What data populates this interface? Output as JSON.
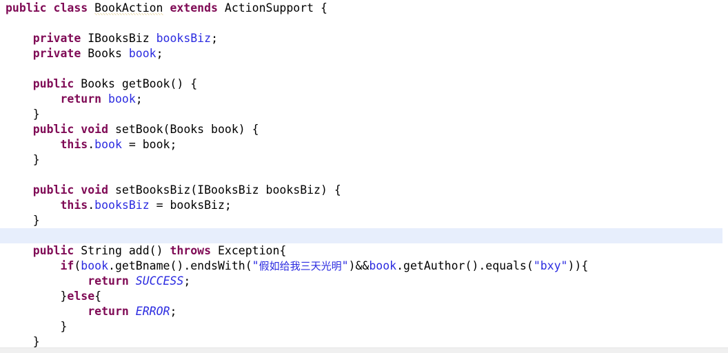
{
  "editor": {
    "language": "java",
    "class_name": "BookAction",
    "colors": {
      "background": "#ffffff",
      "foreground": "#000000",
      "keyword": "#7f0a55",
      "identifier": "#2a2ae0",
      "string": "#2a2ae0",
      "constant": "#2a2ae0",
      "current_line_highlight": "#e7eefc",
      "warning_underline": "#c9a227",
      "status_strip": "#f0f0f0"
    },
    "current_line_number": 17,
    "warning_token": "BookAction"
  },
  "code": {
    "lines": [
      {
        "n": 1,
        "indent": 0,
        "tokens": [
          {
            "t": "kw",
            "v": "public"
          },
          {
            "t": "pl",
            "v": " "
          },
          {
            "t": "kw",
            "v": "class"
          },
          {
            "t": "pl",
            "v": " "
          },
          {
            "t": "warn",
            "v": "BookAction"
          },
          {
            "t": "pl",
            "v": " "
          },
          {
            "t": "kw",
            "v": "extends"
          },
          {
            "t": "pl",
            "v": " ActionSupport {"
          }
        ]
      },
      {
        "n": 2,
        "indent": 0,
        "tokens": []
      },
      {
        "n": 3,
        "indent": 1,
        "tokens": [
          {
            "t": "kw",
            "v": "private"
          },
          {
            "t": "pl",
            "v": " IBooksBiz "
          },
          {
            "t": "id",
            "v": "booksBiz"
          },
          {
            "t": "pl",
            "v": ";"
          }
        ]
      },
      {
        "n": 4,
        "indent": 1,
        "tokens": [
          {
            "t": "kw",
            "v": "private"
          },
          {
            "t": "pl",
            "v": " Books "
          },
          {
            "t": "id",
            "v": "book"
          },
          {
            "t": "pl",
            "v": ";"
          }
        ]
      },
      {
        "n": 5,
        "indent": 0,
        "tokens": []
      },
      {
        "n": 6,
        "indent": 1,
        "tokens": [
          {
            "t": "kw",
            "v": "public"
          },
          {
            "t": "pl",
            "v": " Books getBook() {"
          }
        ]
      },
      {
        "n": 7,
        "indent": 2,
        "tokens": [
          {
            "t": "kw",
            "v": "return"
          },
          {
            "t": "pl",
            "v": " "
          },
          {
            "t": "id",
            "v": "book"
          },
          {
            "t": "pl",
            "v": ";"
          }
        ]
      },
      {
        "n": 8,
        "indent": 1,
        "tokens": [
          {
            "t": "pl",
            "v": "}"
          }
        ]
      },
      {
        "n": 9,
        "indent": 1,
        "tokens": [
          {
            "t": "kw",
            "v": "public"
          },
          {
            "t": "pl",
            "v": " "
          },
          {
            "t": "kw",
            "v": "void"
          },
          {
            "t": "pl",
            "v": " setBook(Books book) {"
          }
        ]
      },
      {
        "n": 10,
        "indent": 2,
        "tokens": [
          {
            "t": "kw",
            "v": "this"
          },
          {
            "t": "pl",
            "v": "."
          },
          {
            "t": "id",
            "v": "book"
          },
          {
            "t": "pl",
            "v": " = book;"
          }
        ]
      },
      {
        "n": 11,
        "indent": 1,
        "tokens": [
          {
            "t": "pl",
            "v": "}"
          }
        ]
      },
      {
        "n": 12,
        "indent": 0,
        "tokens": []
      },
      {
        "n": 13,
        "indent": 1,
        "tokens": [
          {
            "t": "kw",
            "v": "public"
          },
          {
            "t": "pl",
            "v": " "
          },
          {
            "t": "kw",
            "v": "void"
          },
          {
            "t": "pl",
            "v": " setBooksBiz(IBooksBiz booksBiz) {"
          }
        ]
      },
      {
        "n": 14,
        "indent": 2,
        "tokens": [
          {
            "t": "kw",
            "v": "this"
          },
          {
            "t": "pl",
            "v": "."
          },
          {
            "t": "id",
            "v": "booksBiz"
          },
          {
            "t": "pl",
            "v": " = booksBiz;"
          }
        ]
      },
      {
        "n": 15,
        "indent": 1,
        "tokens": [
          {
            "t": "pl",
            "v": "}"
          }
        ]
      },
      {
        "n": 16,
        "indent": 0,
        "tokens": [],
        "highlight": true
      },
      {
        "n": 17,
        "indent": 1,
        "tokens": [
          {
            "t": "kw",
            "v": "public"
          },
          {
            "t": "pl",
            "v": " String add() "
          },
          {
            "t": "kw",
            "v": "throws"
          },
          {
            "t": "pl",
            "v": " Exception{"
          }
        ]
      },
      {
        "n": 18,
        "indent": 2,
        "tokens": [
          {
            "t": "kw",
            "v": "if"
          },
          {
            "t": "pl",
            "v": "("
          },
          {
            "t": "id",
            "v": "book"
          },
          {
            "t": "pl",
            "v": ".getBname().endsWith("
          },
          {
            "t": "str",
            "v": "\"假如给我三天光明\""
          },
          {
            "t": "pl",
            "v": ")&&"
          },
          {
            "t": "id",
            "v": "book"
          },
          {
            "t": "pl",
            "v": ".getAuthor().equals("
          },
          {
            "t": "str",
            "v": "\"bxy\""
          },
          {
            "t": "pl",
            "v": ")){"
          }
        ]
      },
      {
        "n": 19,
        "indent": 3,
        "tokens": [
          {
            "t": "kw",
            "v": "return"
          },
          {
            "t": "pl",
            "v": " "
          },
          {
            "t": "const",
            "v": "SUCCESS"
          },
          {
            "t": "pl",
            "v": ";"
          }
        ]
      },
      {
        "n": 20,
        "indent": 2,
        "tokens": [
          {
            "t": "pl",
            "v": "}"
          },
          {
            "t": "kw",
            "v": "else"
          },
          {
            "t": "pl",
            "v": "{"
          }
        ]
      },
      {
        "n": 21,
        "indent": 3,
        "tokens": [
          {
            "t": "kw",
            "v": "return"
          },
          {
            "t": "pl",
            "v": " "
          },
          {
            "t": "const",
            "v": "ERROR"
          },
          {
            "t": "pl",
            "v": ";"
          }
        ]
      },
      {
        "n": 22,
        "indent": 2,
        "tokens": [
          {
            "t": "pl",
            "v": "}"
          }
        ]
      },
      {
        "n": 23,
        "indent": 1,
        "tokens": [
          {
            "t": "pl",
            "v": "}"
          }
        ]
      }
    ]
  }
}
